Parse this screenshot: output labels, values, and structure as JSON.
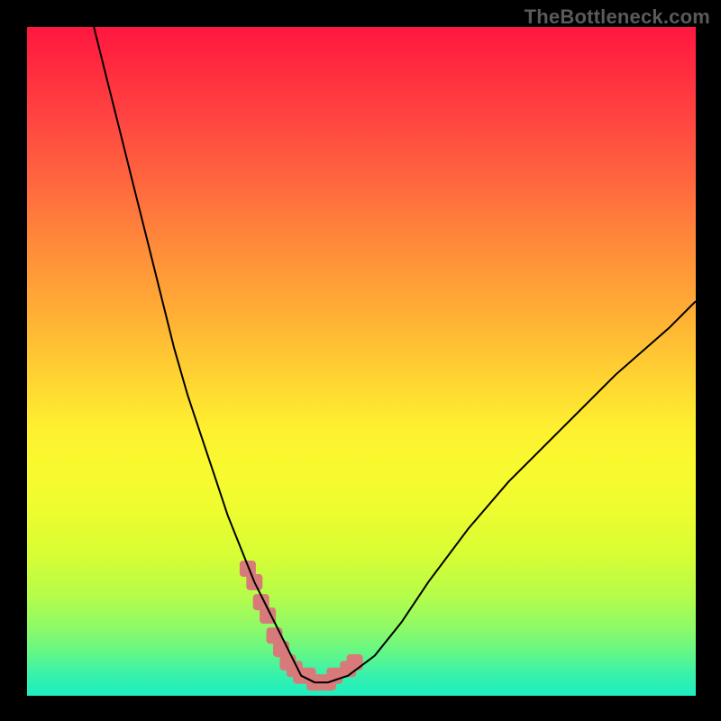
{
  "watermark": "TheBottleneck.com",
  "chart_data": {
    "type": "line",
    "title": "",
    "xlabel": "",
    "ylabel": "",
    "xlim": [
      0,
      100
    ],
    "ylim": [
      0,
      100
    ],
    "grid": false,
    "legend": false,
    "series": [
      {
        "name": "bottleneck-curve",
        "color": "#000000",
        "x": [
          10,
          12,
          14,
          16,
          18,
          20,
          22,
          24,
          26,
          28,
          30,
          32,
          34,
          36,
          38,
          40,
          41,
          43,
          45,
          48,
          52,
          56,
          60,
          66,
          72,
          80,
          88,
          96,
          100
        ],
        "y": [
          100,
          92,
          84,
          76,
          68,
          60,
          52,
          45,
          39,
          33,
          27,
          22,
          17,
          13,
          9,
          5,
          3,
          2,
          2,
          3,
          6,
          11,
          17,
          25,
          32,
          40,
          48,
          55,
          59
        ]
      },
      {
        "name": "highlighted-minimum",
        "color": "#d87a7a",
        "marker": "square",
        "x": [
          33,
          34,
          35,
          36,
          37,
          38,
          39,
          40,
          41,
          42,
          43,
          44,
          45,
          46,
          48,
          49
        ],
        "y": [
          19,
          17,
          14,
          12,
          9,
          7,
          5,
          4,
          3,
          3,
          2,
          2,
          2,
          3,
          4,
          5
        ]
      }
    ],
    "gradient_stops": [
      {
        "pos": 0.0,
        "color": "#ff173f"
      },
      {
        "pos": 0.2,
        "color": "#ff6a3e"
      },
      {
        "pos": 0.4,
        "color": "#ffaf35"
      },
      {
        "pos": 0.6,
        "color": "#fef030"
      },
      {
        "pos": 0.8,
        "color": "#d7fd35"
      },
      {
        "pos": 0.95,
        "color": "#5ef68b"
      },
      {
        "pos": 1.0,
        "color": "#1eeec0"
      }
    ]
  }
}
